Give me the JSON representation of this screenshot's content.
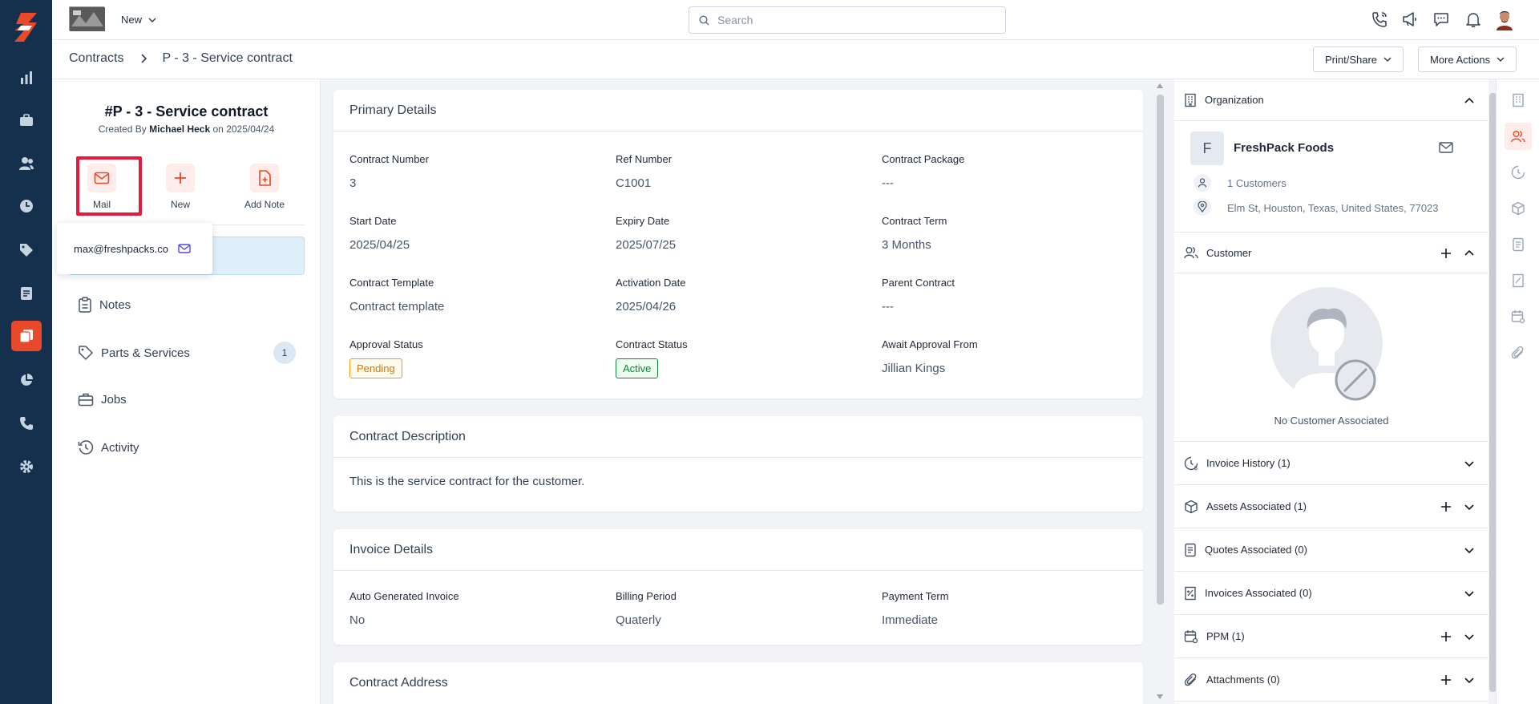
{
  "topbar": {
    "new_label": "New",
    "search_placeholder": "Search"
  },
  "breadcrumb": {
    "root": "Contracts",
    "current": "P - 3 - Service contract"
  },
  "header_actions": {
    "print_share": "Print/Share",
    "more_actions": "More Actions"
  },
  "record": {
    "title": "#P - 3 - Service contract",
    "created_prefix": "Created By",
    "created_by": "Michael Heck",
    "created_on_prefix": "on",
    "created_on": "2025/04/24"
  },
  "quick_actions": {
    "mail": "Mail",
    "new": "New",
    "add_note": "Add Note"
  },
  "mail_popover": {
    "email": "max@freshpacks.co"
  },
  "side_menu": {
    "notes": "Notes",
    "parts_services": "Parts & Services",
    "parts_services_count": "1",
    "jobs": "Jobs",
    "activity": "Activity"
  },
  "primary_details": {
    "title": "Primary Details",
    "contract_number_label": "Contract Number",
    "contract_number": "3",
    "ref_number_label": "Ref Number",
    "ref_number": "C1001",
    "contract_package_label": "Contract Package",
    "contract_package": "---",
    "start_date_label": "Start Date",
    "start_date": "2025/04/25",
    "expiry_date_label": "Expiry Date",
    "expiry_date": "2025/07/25",
    "contract_term_label": "Contract Term",
    "contract_term": "3 Months",
    "contract_template_label": "Contract Template",
    "contract_template": "Contract template",
    "activation_date_label": "Activation Date",
    "activation_date": "2025/04/26",
    "parent_contract_label": "Parent Contract",
    "parent_contract": "---",
    "approval_status_label": "Approval Status",
    "approval_status": "Pending",
    "contract_status_label": "Contract Status",
    "contract_status": "Active",
    "await_approval_label": "Await Approval From",
    "await_approval": "Jillian Kings"
  },
  "contract_description": {
    "title": "Contract Description",
    "text": "This is the service contract for the customer."
  },
  "invoice_details": {
    "title": "Invoice Details",
    "auto_generated_label": "Auto Generated Invoice",
    "auto_generated": "No",
    "billing_period_label": "Billing Period",
    "billing_period": "Quaterly",
    "payment_term_label": "Payment Term",
    "payment_term": "Immediate"
  },
  "contract_address": {
    "title": "Contract Address"
  },
  "organization": {
    "section_title": "Organization",
    "avatar_letter": "F",
    "name": "FreshPack Foods",
    "customers": "1 Customers",
    "address": "Elm St, Houston, Texas, United States, 77023"
  },
  "customer": {
    "section_title": "Customer",
    "empty_text": "No Customer Associated"
  },
  "right_sections": {
    "invoice_history": "Invoice History (1)",
    "assets_associated": "Assets Associated (1)",
    "quotes_associated": "Quotes Associated (0)",
    "invoices_associated": "Invoices Associated (0)",
    "ppm": "PPM (1)",
    "attachments": "Attachments (0)"
  },
  "colors": {
    "nav_bg": "#15304c",
    "accent": "#e8492a",
    "highlight": "#e8193c",
    "pending": "#d97706",
    "active": "#15803d"
  }
}
